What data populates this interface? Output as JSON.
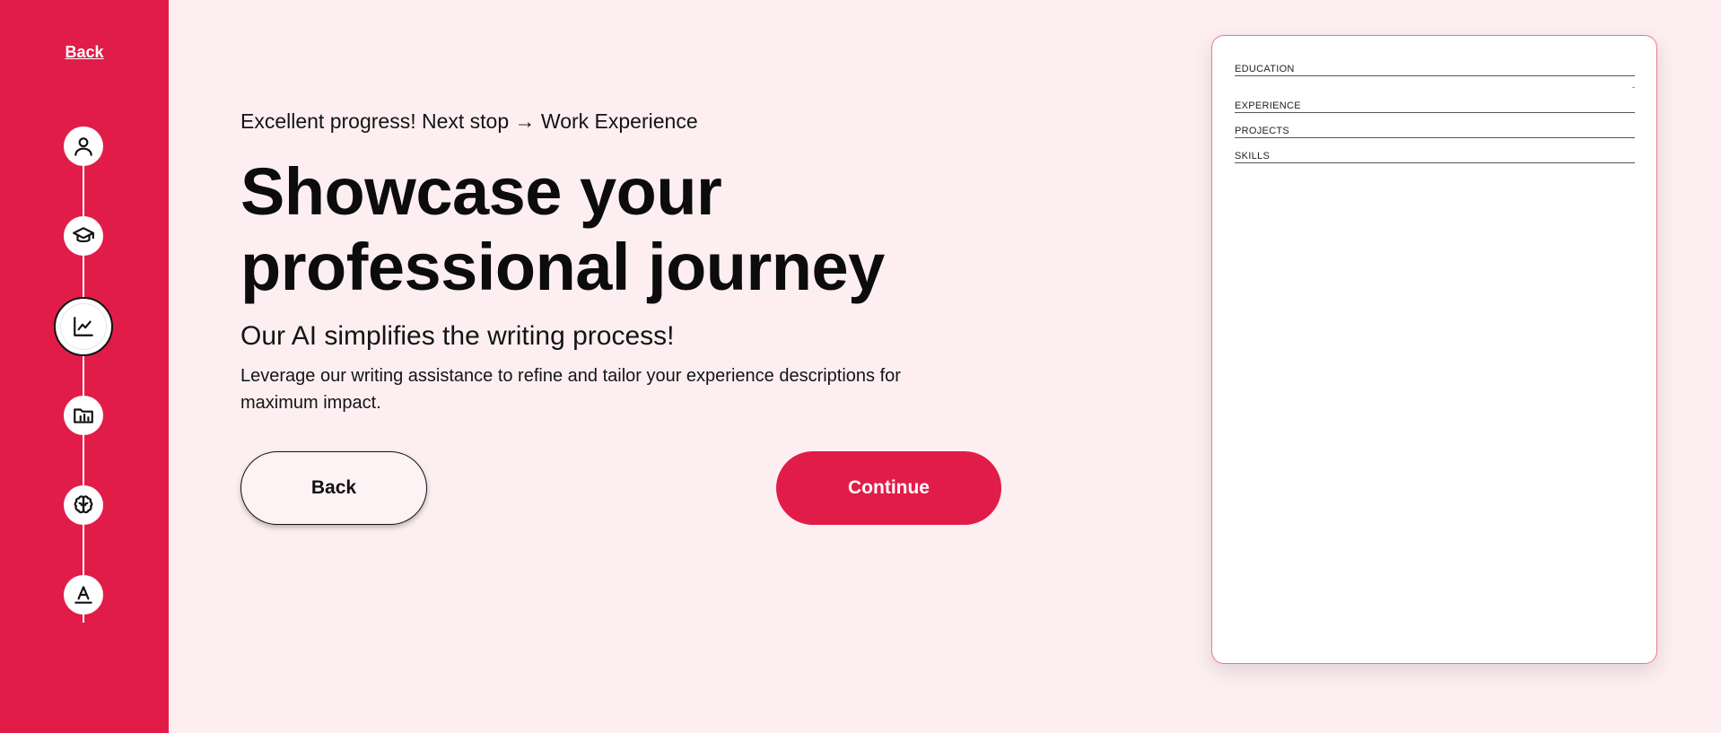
{
  "sidebar": {
    "back_label": "Back",
    "steps": [
      {
        "icon": "person-icon",
        "active": false
      },
      {
        "icon": "graduation-cap-icon",
        "active": false
      },
      {
        "icon": "chart-line-icon",
        "active": true
      },
      {
        "icon": "folder-icon",
        "active": false
      },
      {
        "icon": "brain-icon",
        "active": false
      },
      {
        "icon": "text-style-icon",
        "active": false
      }
    ]
  },
  "main": {
    "kicker": "Excellent progress! Next stop → Work Experience",
    "headline": "Showcase your professional journey",
    "subhead": "Our AI simplifies the writing process!",
    "description": "Leverage our writing assistance to refine and tailor your experience descriptions for maximum impact.",
    "back_button": "Back",
    "continue_button": "Continue"
  },
  "preview": {
    "sections": [
      "EDUCATION",
      "EXPERIENCE",
      "PROJECTS",
      "SKILLS"
    ],
    "dash": "-"
  },
  "colors": {
    "accent": "#e21c48",
    "background": "#fdeff1"
  }
}
